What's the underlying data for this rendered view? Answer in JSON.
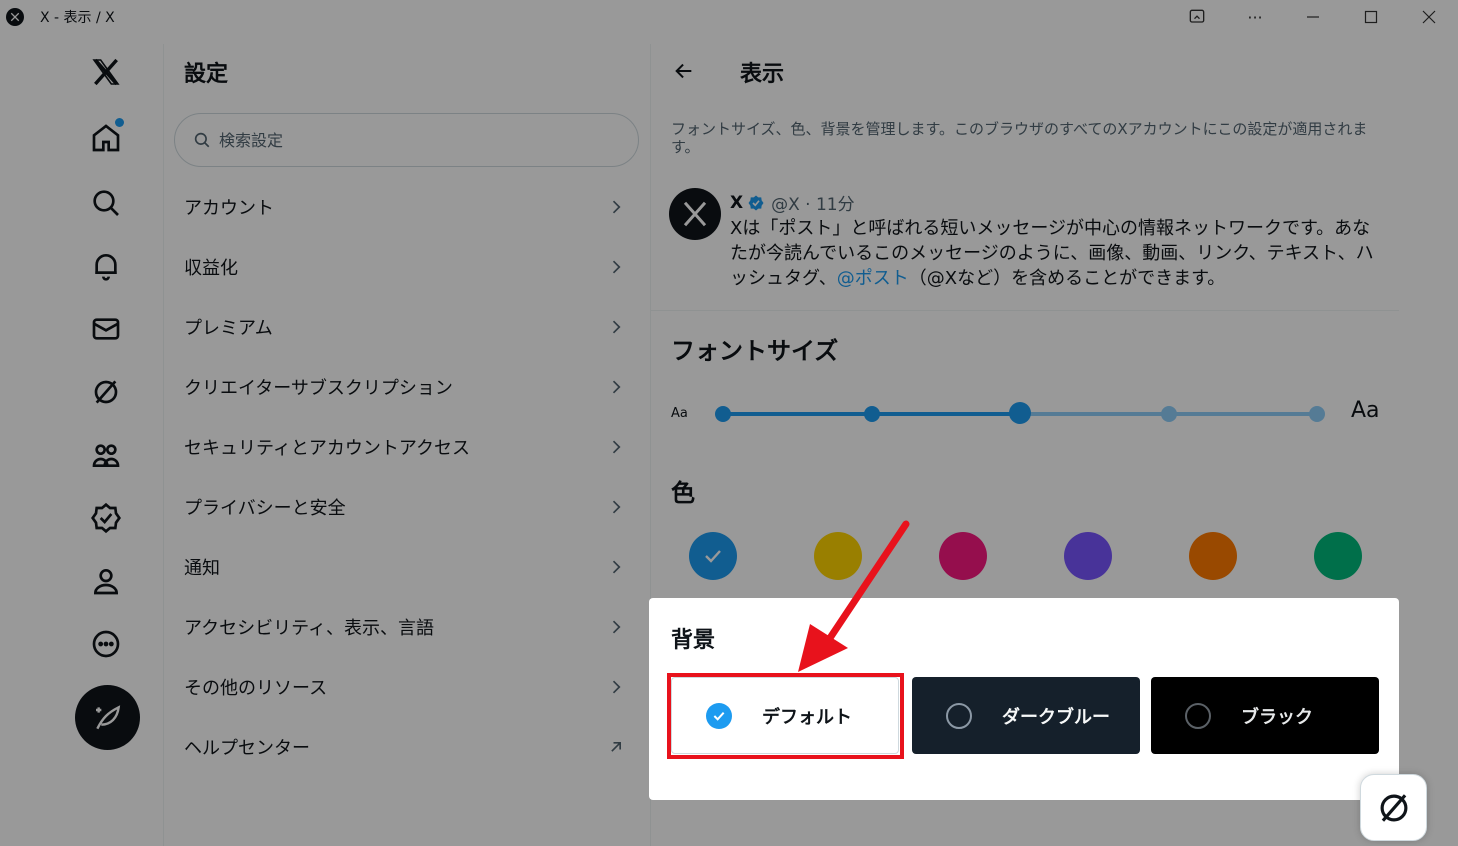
{
  "window": {
    "title": "X - 表示 / X"
  },
  "settings": {
    "title": "設定",
    "search_placeholder": "検索設定",
    "items": [
      {
        "label": "アカウント"
      },
      {
        "label": "収益化"
      },
      {
        "label": "プレミアム"
      },
      {
        "label": "クリエイターサブスクリプション"
      },
      {
        "label": "セキュリティとアカウントアクセス"
      },
      {
        "label": "プライバシーと安全"
      },
      {
        "label": "通知"
      },
      {
        "label": "アクセシビリティ、表示、言語"
      },
      {
        "label": "その他のリソース"
      },
      {
        "label": "ヘルプセンター"
      }
    ]
  },
  "display": {
    "title": "表示",
    "description": "フォントサイズ、色、背景を管理します。このブラウザのすべてのXアカウントにこの設定が適用されます。",
    "tweet": {
      "name": "X",
      "meta": "@X · 11分",
      "body_pre": "Xは「ポスト」と呼ばれる短いメッセージが中心の情報ネットワークです。あなたが今読んでいるこのメッセージのように、画像、動画、リンク、テキスト、ハッシュタグ、",
      "body_link": "@ポスト",
      "body_post": "（@Xなど）を含めることができます。"
    },
    "font_size": {
      "title": "フォントサイズ",
      "small_label": "Aa",
      "large_label": "Aa",
      "steps": 5,
      "selected_index": 2
    },
    "color": {
      "title": "色",
      "options": [
        "#1d9bf0",
        "#ffd400",
        "#f91880",
        "#7856ff",
        "#ff7a00",
        "#00ba7c"
      ],
      "selected_index": 0
    },
    "background": {
      "title": "背景",
      "options": [
        {
          "label": "デフォルト",
          "selected": true
        },
        {
          "label": "ダークブルー",
          "selected": false
        },
        {
          "label": "ブラック",
          "selected": false
        }
      ]
    }
  },
  "colors": {
    "accent": "#1d9bf0",
    "annotation": "#e8121c"
  }
}
